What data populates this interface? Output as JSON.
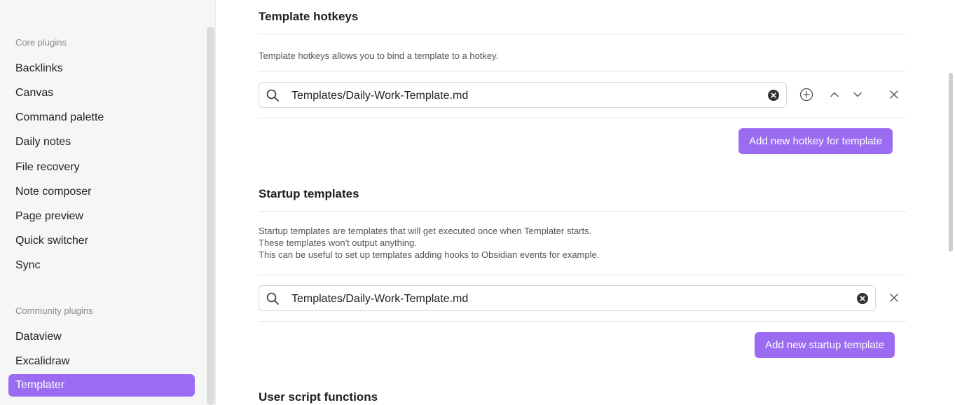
{
  "sidebar": {
    "core_heading": "Core plugins",
    "core_items": [
      "Backlinks",
      "Canvas",
      "Command palette",
      "Daily notes",
      "File recovery",
      "Note composer",
      "Page preview",
      "Quick switcher",
      "Sync"
    ],
    "community_heading": "Community plugins",
    "community_items": [
      "Dataview",
      "Excalidraw",
      "Templater"
    ],
    "active_item": "Templater"
  },
  "hotkeys": {
    "title": "Template hotkeys",
    "description": "Template hotkeys allows you to bind a template to a hotkey.",
    "entry_value": "Templates/Daily-Work-Template.md",
    "add_button": "Add new hotkey for template"
  },
  "startup": {
    "title": "Startup templates",
    "description_lines": [
      "Startup templates are templates that will get executed once when Templater starts.",
      "These templates won't output anything.",
      "This can be useful to set up templates adding hooks to Obsidian events for example."
    ],
    "entry_value": "Templates/Daily-Work-Template.md",
    "add_button": "Add new startup template"
  },
  "user_scripts": {
    "title": "User script functions"
  },
  "colors": {
    "accent": "#9b6cf2",
    "sidebar_bg": "#f6f6f6"
  },
  "icons": [
    "search-icon",
    "clear-icon",
    "add-circle-icon",
    "chevron-up-icon",
    "chevron-down-icon",
    "close-icon"
  ]
}
